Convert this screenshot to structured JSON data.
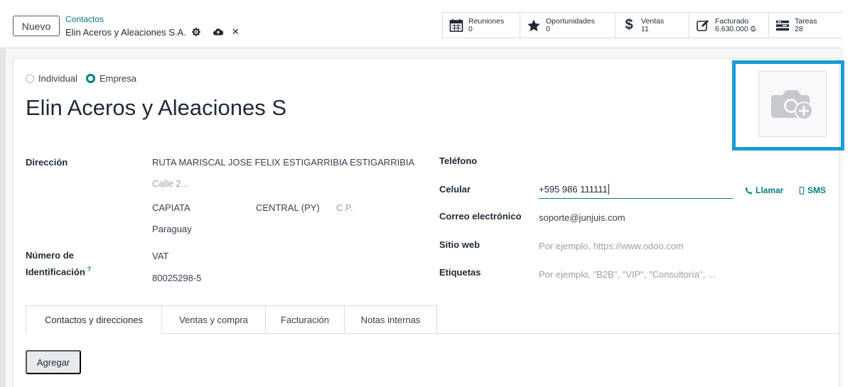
{
  "topbar": {
    "new_label": "Nuevo",
    "breadcrumb": "Contactos",
    "record_name": "Elin Aceros y Aleaciones S.A."
  },
  "smart_buttons": [
    {
      "label": "Reuniones",
      "value": "0",
      "icon": "calendar-icon"
    },
    {
      "label": "Oportunidades",
      "value": "0",
      "icon": "star-icon"
    },
    {
      "label": "Ventas",
      "value": "11",
      "icon": "dollar-icon"
    },
    {
      "label": "Facturado",
      "value": "6.630.000 ₲",
      "icon": "edit-icon"
    },
    {
      "label": "Tareas",
      "value": "28",
      "icon": "tasks-icon"
    }
  ],
  "form": {
    "type_options": [
      "Individual",
      "Empresa"
    ],
    "selected_type": "Empresa",
    "name": "Elin Aceros y Aleaciones S",
    "address": {
      "label": "Dirección",
      "street": "RUTA MARISCAL JOSE FELIX ESTIGARRIBIA ESTIGARRIBIA",
      "street2_placeholder": "Calle 2...",
      "city": "CAPIATA",
      "state": "CENTRAL (PY)",
      "zip_placeholder": "C.P.",
      "country": "Paraguay"
    },
    "identification": {
      "label_line1": "Número de",
      "label_line2": "Identificación",
      "help": "?",
      "type": "VAT",
      "number": "80025298-5"
    },
    "phone_label": "Teléfono",
    "mobile_label": "Celular",
    "mobile_value": "+595 986 111111",
    "call_label": "Llamar",
    "sms_label": "SMS",
    "email_label": "Correo electrónico",
    "email_value": "soporte@junjuis.com",
    "website_label": "Sitio web",
    "website_placeholder": "Por ejemplo, https://www.odoo.com",
    "tags_label": "Etiquetas",
    "tags_placeholder": "Por ejemplo, \"B2B\", \"VIP\", \"Consultoría\", ..."
  },
  "tabs": [
    "Contactos y direcciones",
    "Ventas y compra",
    "Facturación",
    "Notas internas"
  ],
  "active_tab": "Contactos y direcciones",
  "add_label": "Agregar",
  "colors": {
    "accent": "#017e84",
    "brand": "#714b67",
    "highlight": "#1d9bd8"
  }
}
